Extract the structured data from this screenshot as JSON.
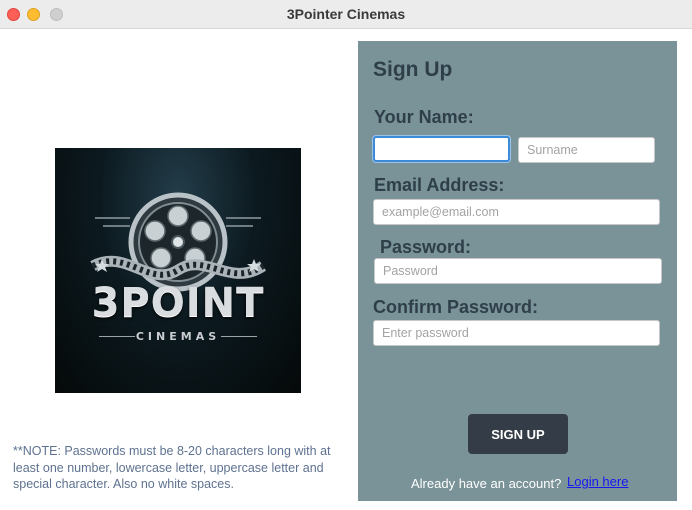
{
  "window": {
    "title": "3Pointer Cinemas"
  },
  "logo": {
    "main_text": "3POINT",
    "sub_text": "CINEMAS"
  },
  "note": "**NOTE: Passwords must be 8-20 characters long with at least one number, lowercase letter, uppercase letter and special character. Also no white spaces.",
  "form": {
    "heading": "Sign Up",
    "name_label": "Your Name:",
    "first_name": {
      "value": "",
      "placeholder": ""
    },
    "surname": {
      "value": "",
      "placeholder": "Surname"
    },
    "email_label": "Email Address:",
    "email": {
      "value": "",
      "placeholder": "example@email.com"
    },
    "password_label": "Password:",
    "password": {
      "value": "",
      "placeholder": "Password"
    },
    "confirm_label": "Confirm Password:",
    "confirm": {
      "value": "",
      "placeholder": "Enter password"
    },
    "signup_button": "SIGN UP",
    "account_text": "Already have an account?",
    "login_link": "Login here"
  },
  "colors": {
    "panel_bg": "#7a9398",
    "label_text": "#2f3f4a",
    "button_bg": "#333c47",
    "link": "#1717f0",
    "note_text": "#5e7290",
    "focus_ring": "#3d8ad6"
  }
}
